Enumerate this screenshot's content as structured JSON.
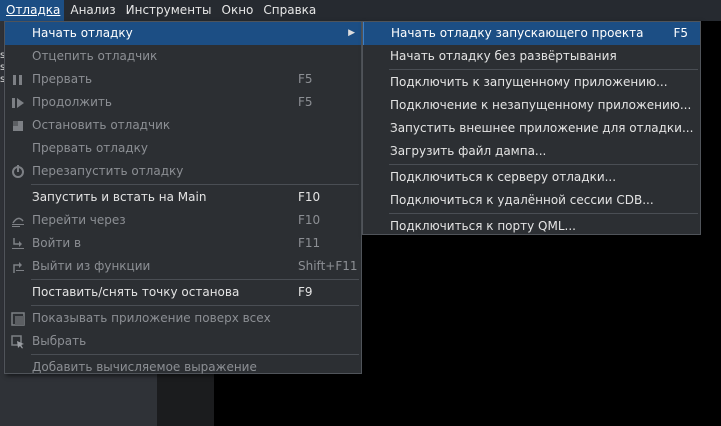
{
  "menubar": {
    "items": [
      "Отладка",
      "Анализ",
      "Инструменты",
      "Окно",
      "Справка"
    ]
  },
  "left_edge_marks": [
    "s",
    "s",
    "s"
  ],
  "debug_menu": {
    "items": [
      {
        "label": "Начать отладку",
        "shortcut": "",
        "enabled": true,
        "has_submenu": true
      },
      {
        "label": "Отцепить отладчик",
        "shortcut": "",
        "enabled": false
      },
      {
        "label": "Прервать",
        "shortcut": "F5",
        "enabled": false,
        "icon": "pause-icon"
      },
      {
        "label": "Продолжить",
        "shortcut": "F5",
        "enabled": false,
        "icon": "continue-icon"
      },
      {
        "label": "Остановить отладчик",
        "shortcut": "",
        "enabled": false,
        "icon": "stop-icon"
      },
      {
        "label": "Прервать отладку",
        "shortcut": "",
        "enabled": false
      },
      {
        "label": "Перезапустить отладку",
        "shortcut": "",
        "enabled": false,
        "icon": "restart-icon"
      },
      {
        "label": "Запустить и встать на Main",
        "shortcut": "F10",
        "enabled": true
      },
      {
        "label": "Перейти через",
        "shortcut": "F10",
        "enabled": false,
        "icon": "step-over-icon"
      },
      {
        "label": "Войти в",
        "shortcut": "F11",
        "enabled": false,
        "icon": "step-into-icon"
      },
      {
        "label": "Выйти из функции",
        "shortcut": "Shift+F11",
        "enabled": false,
        "icon": "step-out-icon"
      },
      {
        "label": "Поставить/снять точку останова",
        "shortcut": "F9",
        "enabled": true
      },
      {
        "label": "Показывать приложение поверх всех",
        "shortcut": "",
        "enabled": false,
        "icon": "window-on-top-icon"
      },
      {
        "label": "Выбрать",
        "shortcut": "",
        "enabled": false,
        "icon": "select-cursor-icon"
      },
      {
        "label": "Добавить вычисляемое выражение",
        "shortcut": "",
        "enabled": false
      }
    ]
  },
  "start_debug_submenu": {
    "items": [
      {
        "label": "Начать отладку запускающего проекта",
        "shortcut": "F5"
      },
      {
        "label": "Начать отладку без развёртывания",
        "shortcut": ""
      },
      {
        "label": "Подключить к запущенному приложению...",
        "shortcut": ""
      },
      {
        "label": "Подключение к незапущенному приложению...",
        "shortcut": ""
      },
      {
        "label": "Запустить внешнее приложение для отладки...",
        "shortcut": ""
      },
      {
        "label": "Загрузить файл дампа...",
        "shortcut": ""
      },
      {
        "label": "Подключиться к серверу отладки...",
        "shortcut": ""
      },
      {
        "label": "Подключиться к удалённой сессии CDB...",
        "shortcut": ""
      },
      {
        "label": "Подключиться к порту QML...",
        "shortcut": ""
      }
    ]
  },
  "colors": {
    "highlight": "#1c4e84",
    "menu_bg": "#2c2f33",
    "disabled_text": "#8c8f94"
  }
}
